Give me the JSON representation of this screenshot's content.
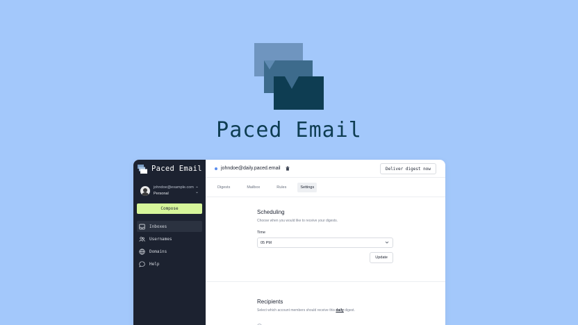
{
  "hero": {
    "title": "Paced Email"
  },
  "sidebar": {
    "brand": "Paced Email",
    "account": {
      "email": "johndoe@example.com",
      "type": "Personal"
    },
    "compose_label": "Compose",
    "nav": [
      {
        "label": "Inboxes",
        "icon": "inbox-icon",
        "active": true
      },
      {
        "label": "Usernames",
        "icon": "users-icon",
        "active": false
      },
      {
        "label": "Domains",
        "icon": "globe-icon",
        "active": false
      },
      {
        "label": "Help",
        "icon": "help-bubble-icon",
        "active": false
      }
    ]
  },
  "header": {
    "address": "johndoe@daily.paced.email",
    "deliver_label": "Deliver digest now"
  },
  "tabs": [
    {
      "label": "Digests",
      "active": false
    },
    {
      "label": "Mailbox",
      "active": false
    },
    {
      "label": "Rules",
      "active": false
    },
    {
      "label": "Settings",
      "active": true
    }
  ],
  "scheduling": {
    "title": "Scheduling",
    "description": "Choose when you would like to receive your digests.",
    "time_label": "Time",
    "time_value": "05 PM",
    "update_label": "Update"
  },
  "recipients": {
    "title": "Recipients",
    "desc_before": "Select which account members should receive this ",
    "desc_link": "daily",
    "desc_after": " digest."
  },
  "colors": {
    "background": "#a3c8fb",
    "sidebar": "#1c2230",
    "compose": "#d6f59a",
    "brand_dark": "#0e3d52"
  }
}
